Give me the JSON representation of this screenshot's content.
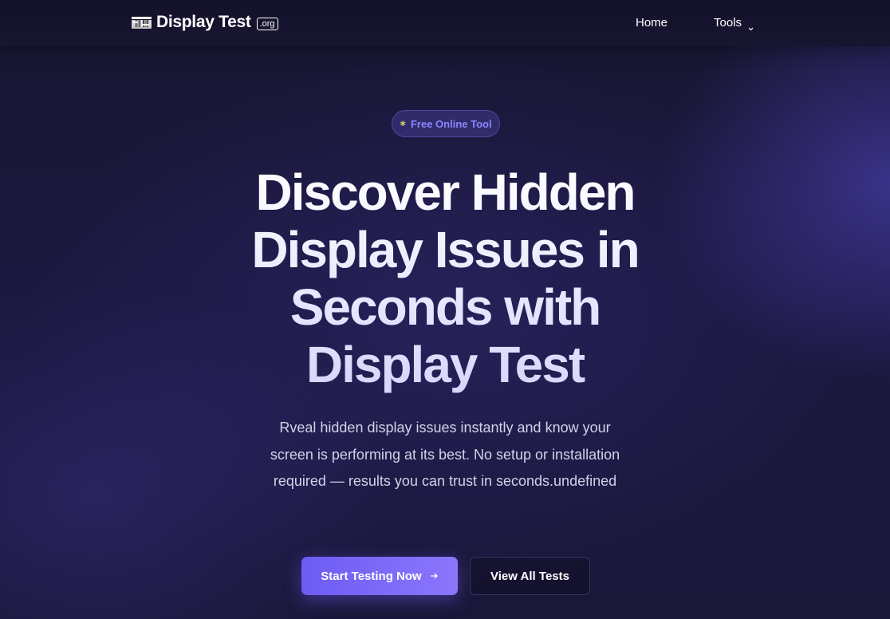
{
  "header": {
    "logo_icon": "display-glitch-icon",
    "logo_text": "Display Test",
    "logo_tld": ".org",
    "nav": {
      "home": "Home",
      "tools": "Tools",
      "tools_icon": "chevron-down-icon"
    }
  },
  "hero": {
    "badge": {
      "icon": "sparkle-icon",
      "label": "Free Online Tool"
    },
    "headline": "Discover Hidden Display Issues in Seconds with Display Test",
    "lead": "Rveal hidden display issues instantly and know your screen is performing at its best. No setup or installation required — results you can trust in seconds.undefined",
    "primary_button": {
      "label": "Start Testing Now",
      "icon": "arrow-right-icon"
    },
    "secondary_button": {
      "label": "View All Tests"
    }
  },
  "colors": {
    "background": "#1b1840",
    "accent": "#7b68f7",
    "badge_text": "#8b86ff",
    "text_muted": "#d3d1e8"
  }
}
